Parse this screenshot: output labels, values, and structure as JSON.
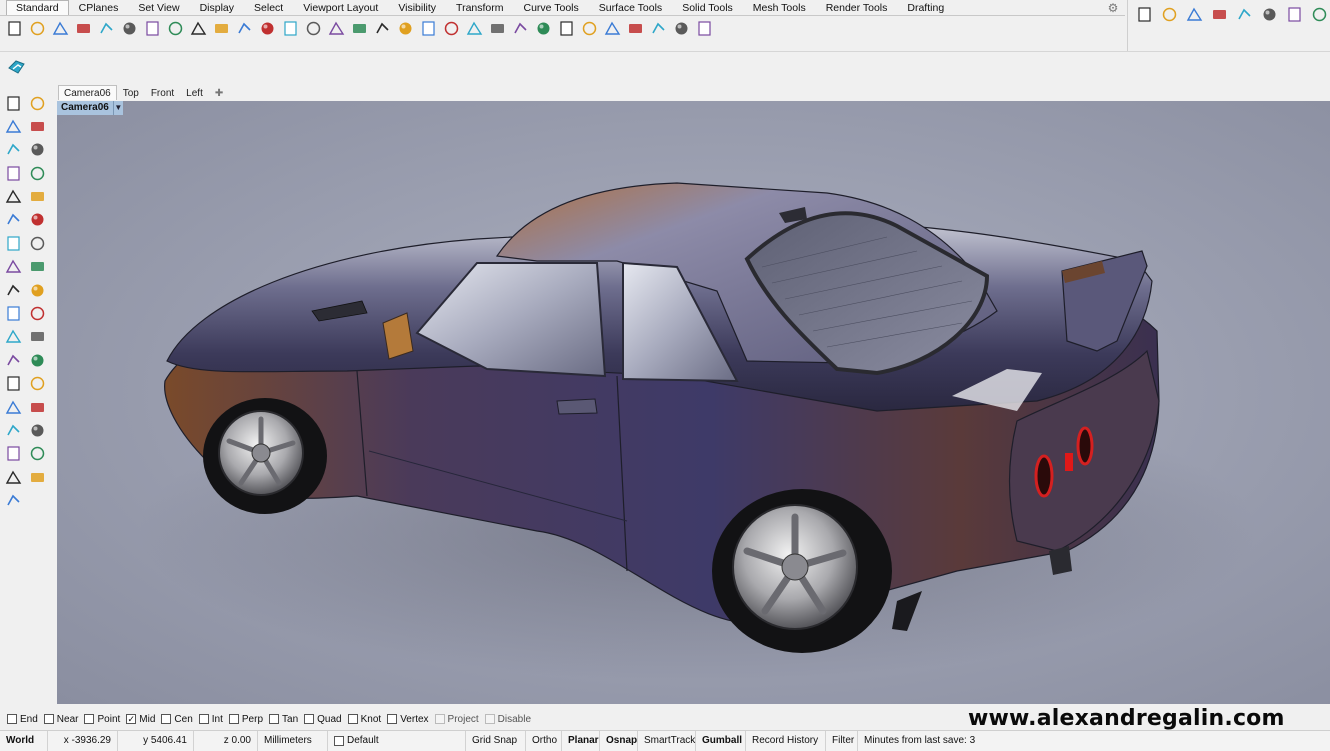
{
  "tabs": [
    {
      "label": "Standard",
      "active": true
    },
    {
      "label": "CPlanes"
    },
    {
      "label": "Set View"
    },
    {
      "label": "Display"
    },
    {
      "label": "Select"
    },
    {
      "label": "Viewport Layout"
    },
    {
      "label": "Visibility"
    },
    {
      "label": "Transform"
    },
    {
      "label": "Curve Tools"
    },
    {
      "label": "Surface Tools"
    },
    {
      "label": "Solid Tools"
    },
    {
      "label": "Mesh Tools"
    },
    {
      "label": "Render Tools"
    },
    {
      "label": "Drafting"
    }
  ],
  "toolbar": {
    "icons": [
      "new-file-icon",
      "open-folder-icon",
      "save-icon",
      "print-icon",
      "import-icon",
      "cut-icon",
      "copy-icon",
      "paste-icon",
      "undo-icon",
      "pan-hand-icon",
      "move-view-icon",
      "zoom-icon",
      "zoom-window-icon",
      "zoom-extents-icon",
      "zoom-selected-icon",
      "rotate-view-icon",
      "four-viewports-icon",
      "car-shade-icon",
      "render-preview-icon",
      "cplane-icon",
      "light-bulb-icon",
      "lock-icon",
      "material-icon",
      "color-wheel-icon",
      "sphere-render-icon",
      "sphere-shaded-icon",
      "sphere-blue-icon",
      "pen-icon",
      "gears-icon",
      "dimension-icon",
      "help-icon"
    ]
  },
  "right_panel": {
    "icons": [
      "rhino-logo-icon",
      "teapot-icon",
      "panel-icon",
      "window-icon",
      "funnel-icon",
      "box-icon",
      "car-icon",
      "grass-icon"
    ]
  },
  "viewport_tabs": [
    "Camera06",
    "Top",
    "Front",
    "Left"
  ],
  "viewport_label": "Camera06",
  "left_toolbox": {
    "icons": [
      "select-arrow-icon",
      "point-icon",
      "polyline-icon",
      "curve-icon",
      "circle-icon",
      "arc-icon",
      "polygon-icon",
      "rectangle-icon",
      "ellipse-icon",
      "curve-freeform-icon",
      "offset-icon",
      "fillet-icon",
      "box-solid-icon",
      "boolean-icon",
      "cylinder-icon",
      "surface-icon",
      "explode-icon",
      "split-icon",
      "trim-icon",
      "extend-icon",
      "sphere-icon",
      "group-icon",
      "rotate-icon",
      "scale-icon",
      "text-icon",
      "array-icon",
      "align-icon",
      "transform-icon",
      "grid-icon",
      "dimension-tool-icon",
      "mesh-icon",
      "check-icon",
      "paint-icon",
      "analyze-icon",
      "layer-icon"
    ]
  },
  "osnaps": [
    {
      "label": "End",
      "checked": false
    },
    {
      "label": "Near",
      "checked": false
    },
    {
      "label": "Point",
      "checked": false
    },
    {
      "label": "Mid",
      "checked": true
    },
    {
      "label": "Cen",
      "checked": false
    },
    {
      "label": "Int",
      "checked": false
    },
    {
      "label": "Perp",
      "checked": false
    },
    {
      "label": "Tan",
      "checked": false
    },
    {
      "label": "Quad",
      "checked": false
    },
    {
      "label": "Knot",
      "checked": false
    },
    {
      "label": "Vertex",
      "checked": false
    },
    {
      "label": "Project",
      "checked": false,
      "disabled": true
    },
    {
      "label": "Disable",
      "checked": false,
      "disabled": true
    }
  ],
  "watermark": "www.alexandregalin.com",
  "statusbar": {
    "world": "World",
    "x": "x -3936.29",
    "y": "y 5406.41",
    "z": "z 0.00",
    "units": "Millimeters",
    "layer": "Default",
    "grid_snap": "Grid Snap",
    "ortho": "Ortho",
    "planar": "Planar",
    "osnap": "Osnap",
    "smarttrack": "SmartTrack",
    "gumball": "Gumball",
    "record_history": "Record History",
    "filter": "Filter",
    "autosave": "Minutes from last save: 3"
  },
  "colors": {
    "viewport_bg": "#9da1b2",
    "viewport_label_bg": "#a9c3de",
    "car_body": "#4a4a6e",
    "tail_light": "#d42020"
  }
}
